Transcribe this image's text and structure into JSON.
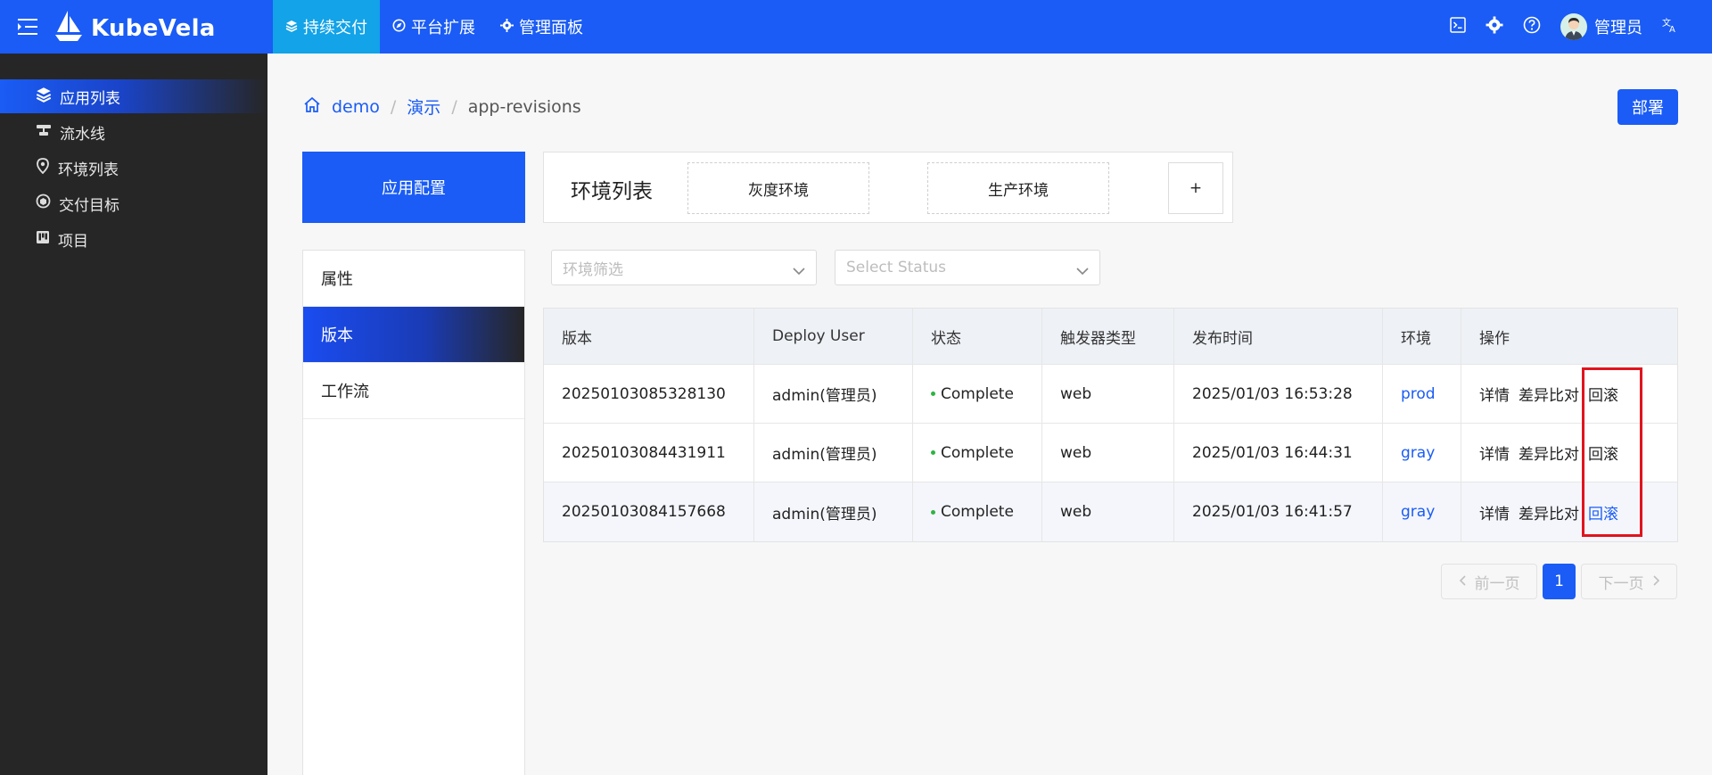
{
  "app": {
    "logo_text": "KubeVela"
  },
  "topnav": [
    {
      "label": "持续交付",
      "active": true
    },
    {
      "label": "平台扩展",
      "active": false
    },
    {
      "label": "管理面板",
      "active": false
    }
  ],
  "user": {
    "name": "管理员"
  },
  "sidebar": {
    "items": [
      {
        "label": "应用列表",
        "active": true
      },
      {
        "label": "流水线"
      },
      {
        "label": "环境列表"
      },
      {
        "label": "交付目标"
      },
      {
        "label": "项目"
      }
    ]
  },
  "breadcrumb": {
    "items": [
      "demo",
      "演示",
      "app-revisions"
    ]
  },
  "deploy_button": "部署",
  "app_config_label": "应用配置",
  "env": {
    "title": "环境列表",
    "cards": [
      "灰度环境",
      "生产环境"
    ],
    "add_label": "+"
  },
  "left_tabs": [
    "属性",
    "版本",
    "工作流"
  ],
  "filters": {
    "env_placeholder": "环境筛选",
    "status_placeholder": "Select Status"
  },
  "table": {
    "headers": [
      "版本",
      "Deploy User",
      "状态",
      "触发器类型",
      "发布时间",
      "环境",
      "操作"
    ],
    "rows": [
      {
        "version": "20250103085328130",
        "user": "admin(管理员)",
        "status": "Complete",
        "trigger": "web",
        "time": "2025/01/03 16:53:28",
        "env": "prod",
        "ops": [
          "详情",
          "差异比对",
          "回滚"
        ]
      },
      {
        "version": "20250103084431911",
        "user": "admin(管理员)",
        "status": "Complete",
        "trigger": "web",
        "time": "2025/01/03 16:44:31",
        "env": "gray",
        "ops": [
          "详情",
          "差异比对",
          "回滚"
        ]
      },
      {
        "version": "20250103084157668",
        "user": "admin(管理员)",
        "status": "Complete",
        "trigger": "web",
        "time": "2025/01/03 16:41:57",
        "env": "gray",
        "ops": [
          "详情",
          "差异比对",
          "回滚"
        ]
      }
    ]
  },
  "pagination": {
    "prev": "前一页",
    "page": "1",
    "next": "下一页"
  },
  "colors": {
    "brand": "#1a5cf5",
    "nav_active": "#12a3e8",
    "sidebar": "#262626",
    "status_ok": "#2fb344",
    "highlight": "#e0141e"
  }
}
